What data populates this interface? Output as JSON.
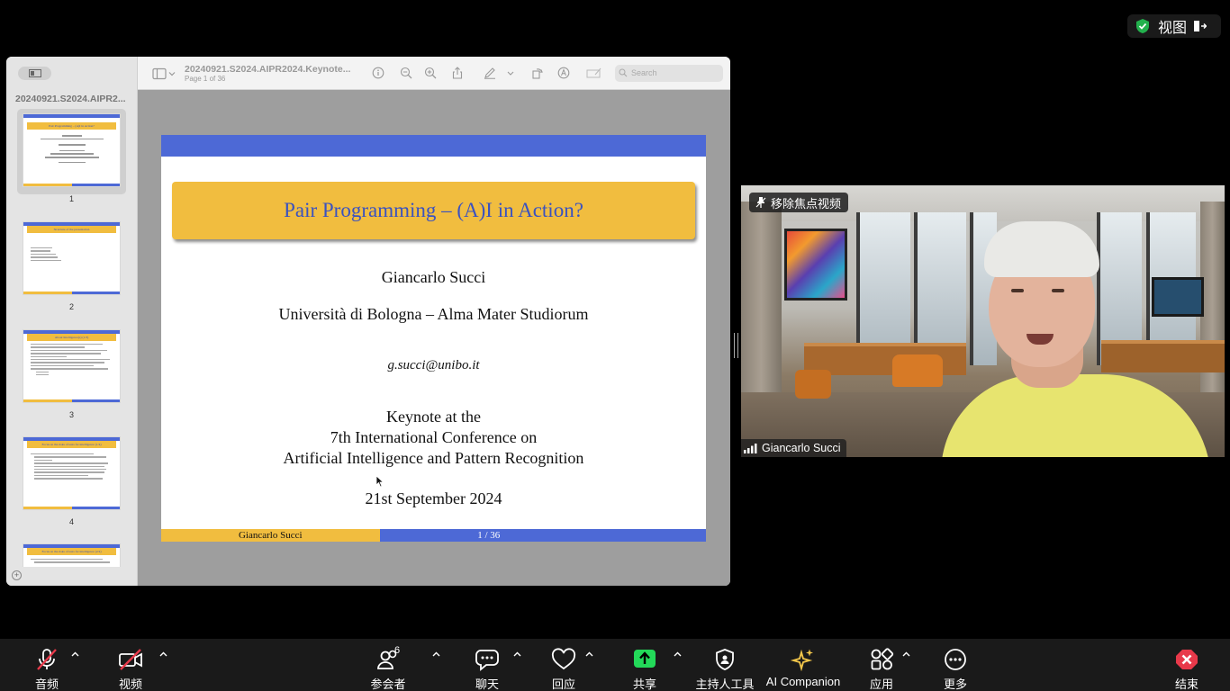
{
  "top": {
    "view_label": "视图"
  },
  "pdf": {
    "sidebar_title": "20240921.S2024.AIPR2...",
    "doc_title": "20240921.S2024.AIPR2024.Keynote...",
    "page_info": "Page 1 of 36",
    "search_placeholder": "Search",
    "thumbnails": [
      {
        "num": "1",
        "head": "Pair Programming – (A)I in Action?"
      },
      {
        "num": "2",
        "head": "Structure of the presentation"
      },
      {
        "num": "3",
        "head": "About Intelligence(s) (1/3)"
      },
      {
        "num": "4",
        "head": "Focus on the risks of tests for intelligence (1/4)"
      },
      {
        "num": "",
        "head": "Focus on the risks of tests for intelligence (2/4)"
      }
    ]
  },
  "slide": {
    "title": "Pair Programming – (A)I in Action?",
    "author": "Giancarlo Succi",
    "affiliation": "Università di Bologna – Alma Mater Studiorum",
    "email": "g.succi@unibo.it",
    "event_line1": "Keynote at the",
    "event_line2": "7th International Conference on",
    "event_line3": "Artificial Intelligence and Pattern Recognition",
    "date": "21st September 2024",
    "footer_author": "Giancarlo Succi",
    "footer_page": "1 / 36"
  },
  "video": {
    "unpin_label": "移除焦点视频",
    "participant_name": "Giancarlo Succi"
  },
  "toolbar": {
    "audio": "音频",
    "video": "视频",
    "participants": "参会者",
    "participants_count": "6",
    "chat": "聊天",
    "react": "回应",
    "share": "共享",
    "host_tools": "主持人工具",
    "ai_companion": "AI Companion",
    "apps": "应用",
    "more": "更多",
    "end": "结束"
  },
  "colors": {
    "slide_blue": "#4d69d6",
    "slide_yellow": "#f1bd3f",
    "share_green": "#23d959",
    "end_red": "#e8394a",
    "ai_gold": "#f5c84b"
  }
}
